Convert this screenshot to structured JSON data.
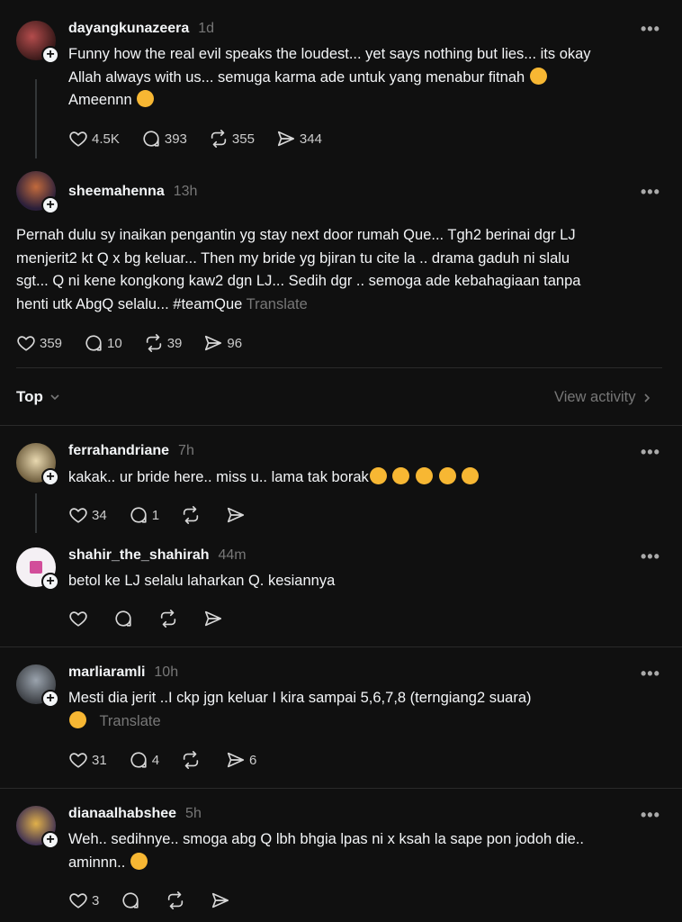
{
  "posts": [
    {
      "username": "dayangkunazeera",
      "time": "1d",
      "text1": "Funny how the real evil speaks the loudest... yet says nothing but lies... its okay",
      "text2": "Allah always with us... semuga karma ade untuk yang menabur fitnah",
      "text3": "Ameennn",
      "likes": "4.5K",
      "replies": "393",
      "reposts": "355",
      "shares": "344"
    },
    {
      "username": "sheemahenna",
      "time": "13h",
      "text1": "Pernah dulu sy inaikan pengantin yg stay next door rumah Que... Tgh2 berinai dgr LJ",
      "text2": "menjerit2 kt Q x bg keluar... Then my bride yg bjiran tu cite la .. drama gaduh ni slalu",
      "text3": "sgt... Q ni kene kongkong kaw2 dgn LJ... Sedih dgr .. semoga ade kebahagiaan tanpa",
      "text4": "henti utk AbgQ selalu... #teamQue",
      "translate": "Translate",
      "likes": "359",
      "replies": "10",
      "reposts": "39",
      "shares": "96"
    }
  ],
  "sort_bar": {
    "label": "Top",
    "view_activity": "View activity"
  },
  "replies": [
    {
      "username": "ferrahandriane",
      "time": "7h",
      "text": "kakak.. ur bride here.. miss u.. lama tak borak",
      "likes": "34",
      "replies": "1"
    },
    {
      "username": "shahir_the_shahirah",
      "time": "44m",
      "text": "betol ke LJ selalu laharkan Q. kesiannya"
    },
    {
      "username": "marliaramli",
      "time": "10h",
      "text1": "Mesti dia jerit ..I ckp jgn keluar I kira sampai 5,6,7,8 (terngiang2 suara)",
      "translate": "Translate",
      "likes": "31",
      "replies": "4",
      "shares": "6"
    },
    {
      "username": "dianaalhabshee",
      "time": "5h",
      "text1": "Weh.. sedihnye.. smoga abg Q lbh bhgia lpas ni x ksah la sape pon jodoh die..",
      "text2": "aminnn..",
      "likes": "3"
    }
  ],
  "more_glyph": "•••",
  "plus_glyph": "+",
  "icons": [
    "heart-icon",
    "reply-icon",
    "repost-icon",
    "share-icon",
    "chevron-down-icon",
    "chevron-right-icon",
    "more-icon"
  ],
  "colors": {
    "background": "#101010",
    "text": "#f3f5f7",
    "muted": "#777777"
  }
}
